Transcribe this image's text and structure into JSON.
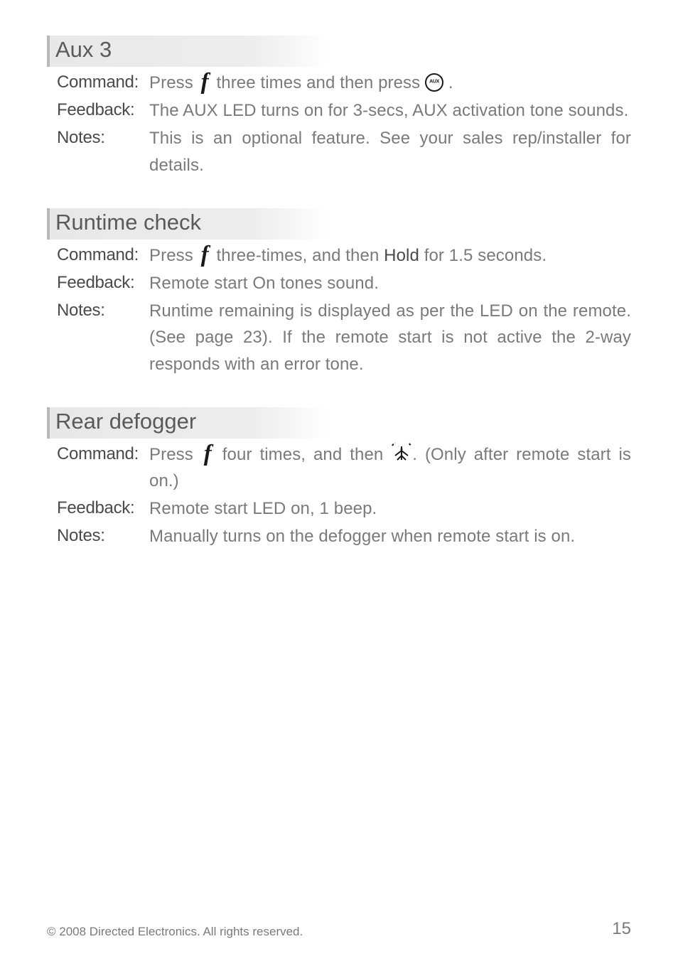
{
  "sections": [
    {
      "heading": "Aux 3",
      "rows": [
        {
          "label": "Command",
          "text1": "Press ",
          "text2": " three times and then press ",
          "text3": " .",
          "icon1": "f",
          "icon2": "aux"
        },
        {
          "label": "Feedback",
          "text": "The AUX LED turns on for 3-secs, AUX activation tone sounds."
        },
        {
          "label": "Notes",
          "text": "This is an optional feature. See your sales rep/installer for details."
        }
      ]
    },
    {
      "heading": "Runtime check",
      "rows": [
        {
          "label": "Command",
          "text1": "Press ",
          "text2": " three-times, and then ",
          "bold": "Hold",
          "text3": " for 1.5 seconds.",
          "icon1": "f"
        },
        {
          "label": "Feedback",
          "text": "Remote start On tones sound."
        },
        {
          "label": "Notes",
          "text": "Runtime remaining is displayed as per the LED on the remote. (See page 23). If the remote start is not active the 2-way responds with an error tone."
        }
      ]
    },
    {
      "heading": "Rear defogger",
      "rows": [
        {
          "label": "Command",
          "text1": "Press ",
          "text2": " four times, and then ",
          "text3": ". (Only after remote start is on.)",
          "icon1": "f",
          "icon2": "defog"
        },
        {
          "label": "Feedback",
          "text": "Remote start LED on, 1 beep."
        },
        {
          "label": "Notes",
          "text": "Manually turns on the defogger when remote start is on."
        }
      ]
    }
  ],
  "footer": {
    "copyright": "© 2008 Directed Electronics. All rights reserved.",
    "page": "15"
  },
  "labels": {
    "command": "Command",
    "feedback": "Feedback",
    "notes": "Notes"
  }
}
